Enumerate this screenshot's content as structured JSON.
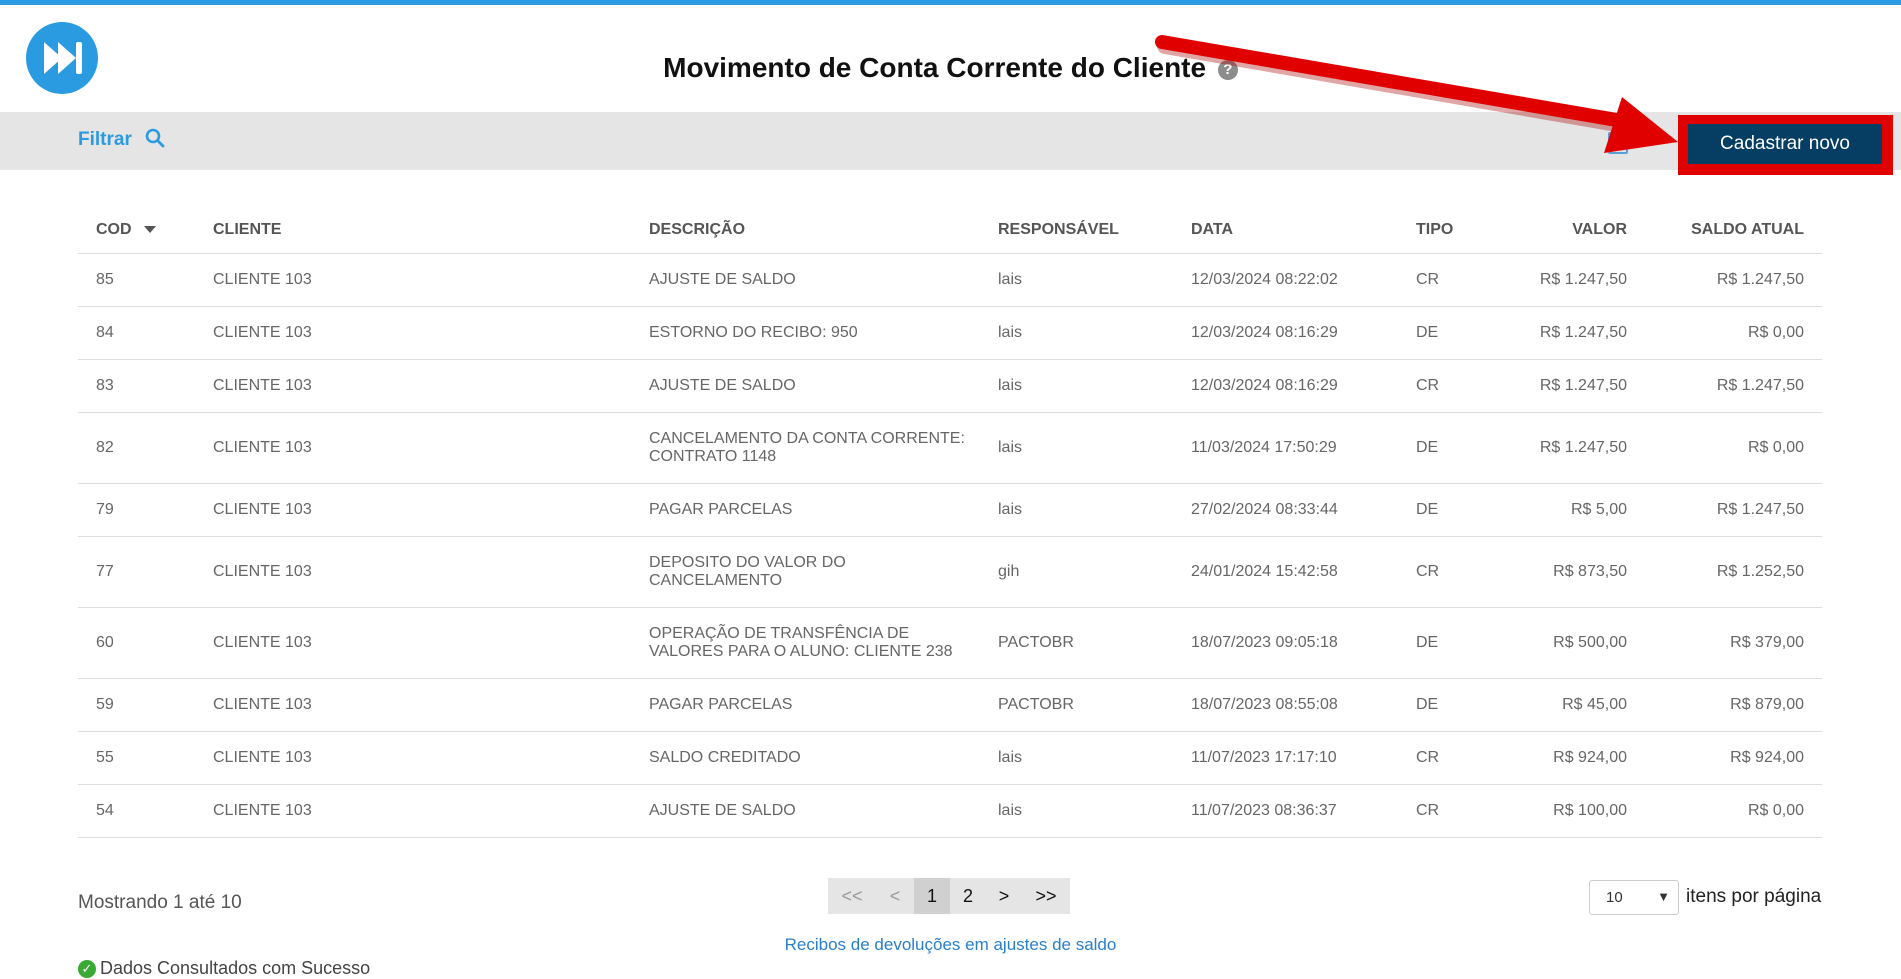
{
  "page": {
    "title": "Movimento de Conta Corrente do Cliente",
    "help_icon": "?"
  },
  "toolbar": {
    "filter_label": "Filtrar",
    "excel_icon": "X",
    "new_button": "Cadastrar novo"
  },
  "table": {
    "headers": [
      "COD",
      "CLIENTE",
      "DESCRIÇÃO",
      "RESPONSÁVEL",
      "DATA",
      "TIPO",
      "VALOR",
      "SALDO ATUAL"
    ],
    "rows": [
      {
        "cod": "85",
        "cliente": "CLIENTE 103",
        "descricao": "AJUSTE DE SALDO",
        "responsavel": "lais",
        "data": "12/03/2024 08:22:02",
        "tipo": "CR",
        "valor": "R$ 1.247,50",
        "saldo": "R$ 1.247,50"
      },
      {
        "cod": "84",
        "cliente": "CLIENTE 103",
        "descricao": "ESTORNO DO RECIBO: 950",
        "responsavel": "lais",
        "data": "12/03/2024 08:16:29",
        "tipo": "DE",
        "valor": "R$ 1.247,50",
        "saldo": "R$ 0,00"
      },
      {
        "cod": "83",
        "cliente": "CLIENTE 103",
        "descricao": "AJUSTE DE SALDO",
        "responsavel": "lais",
        "data": "12/03/2024 08:16:29",
        "tipo": "CR",
        "valor": "R$ 1.247,50",
        "saldo": "R$ 1.247,50"
      },
      {
        "cod": "82",
        "cliente": "CLIENTE 103",
        "descricao": "CANCELAMENTO DA CONTA CORRENTE: CONTRATO 1148",
        "responsavel": "lais",
        "data": "11/03/2024 17:50:29",
        "tipo": "DE",
        "valor": "R$ 1.247,50",
        "saldo": "R$ 0,00"
      },
      {
        "cod": "79",
        "cliente": "CLIENTE 103",
        "descricao": "PAGAR PARCELAS",
        "responsavel": "lais",
        "data": "27/02/2024 08:33:44",
        "tipo": "DE",
        "valor": "R$ 5,00",
        "saldo": "R$ 1.247,50"
      },
      {
        "cod": "77",
        "cliente": "CLIENTE 103",
        "descricao": "DEPOSITO DO VALOR DO CANCELAMENTO",
        "responsavel": "gih",
        "data": "24/01/2024 15:42:58",
        "tipo": "CR",
        "valor": "R$ 873,50",
        "saldo": "R$ 1.252,50"
      },
      {
        "cod": "60",
        "cliente": "CLIENTE 103",
        "descricao": "OPERAÇÃO DE TRANSFÊNCIA DE VALORES PARA O ALUNO: CLIENTE 238",
        "responsavel": "PACTOBR",
        "data": "18/07/2023 09:05:18",
        "tipo": "DE",
        "valor": "R$ 500,00",
        "saldo": "R$ 379,00"
      },
      {
        "cod": "59",
        "cliente": "CLIENTE 103",
        "descricao": "PAGAR PARCELAS",
        "responsavel": "PACTOBR",
        "data": "18/07/2023 08:55:08",
        "tipo": "DE",
        "valor": "R$ 45,00",
        "saldo": "R$ 879,00"
      },
      {
        "cod": "55",
        "cliente": "CLIENTE 103",
        "descricao": "SALDO CREDITADO",
        "responsavel": "lais",
        "data": "11/07/2023 17:17:10",
        "tipo": "CR",
        "valor": "R$ 924,00",
        "saldo": "R$ 924,00"
      },
      {
        "cod": "54",
        "cliente": "CLIENTE 103",
        "descricao": "AJUSTE DE SALDO",
        "responsavel": "lais",
        "data": "11/07/2023 08:36:37",
        "tipo": "CR",
        "valor": "R$ 100,00",
        "saldo": "R$ 0,00"
      }
    ]
  },
  "footer": {
    "showing": "Mostrando 1 até 10",
    "pager": {
      "first": "<<",
      "prev": "<",
      "pages": [
        "1",
        "2"
      ],
      "next": ">",
      "last": ">>"
    },
    "per_page_value": "10",
    "per_page_label": "itens por página",
    "recibos_link": "Recibos de devoluções em ajustes de saldo",
    "status": "Dados Consultados com Sucesso"
  },
  "colors": {
    "accent": "#2a9be0",
    "button": "#053d63",
    "annotation": "#e00000"
  }
}
